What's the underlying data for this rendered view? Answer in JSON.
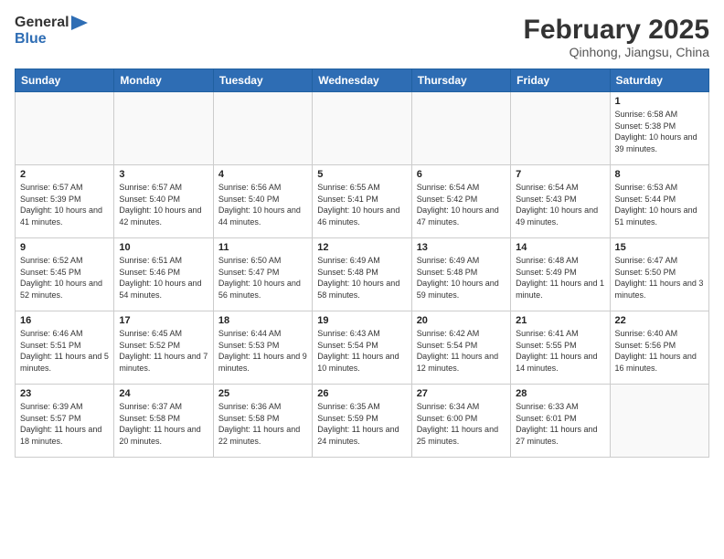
{
  "header": {
    "logo": {
      "general": "General",
      "blue": "Blue"
    },
    "title": "February 2025",
    "location": "Qinhong, Jiangsu, China"
  },
  "weekdays": [
    "Sunday",
    "Monday",
    "Tuesday",
    "Wednesday",
    "Thursday",
    "Friday",
    "Saturday"
  ],
  "weeks": [
    [
      {
        "day": "",
        "info": ""
      },
      {
        "day": "",
        "info": ""
      },
      {
        "day": "",
        "info": ""
      },
      {
        "day": "",
        "info": ""
      },
      {
        "day": "",
        "info": ""
      },
      {
        "day": "",
        "info": ""
      },
      {
        "day": "1",
        "info": "Sunrise: 6:58 AM\nSunset: 5:38 PM\nDaylight: 10 hours and 39 minutes."
      }
    ],
    [
      {
        "day": "2",
        "info": "Sunrise: 6:57 AM\nSunset: 5:39 PM\nDaylight: 10 hours and 41 minutes."
      },
      {
        "day": "3",
        "info": "Sunrise: 6:57 AM\nSunset: 5:40 PM\nDaylight: 10 hours and 42 minutes."
      },
      {
        "day": "4",
        "info": "Sunrise: 6:56 AM\nSunset: 5:40 PM\nDaylight: 10 hours and 44 minutes."
      },
      {
        "day": "5",
        "info": "Sunrise: 6:55 AM\nSunset: 5:41 PM\nDaylight: 10 hours and 46 minutes."
      },
      {
        "day": "6",
        "info": "Sunrise: 6:54 AM\nSunset: 5:42 PM\nDaylight: 10 hours and 47 minutes."
      },
      {
        "day": "7",
        "info": "Sunrise: 6:54 AM\nSunset: 5:43 PM\nDaylight: 10 hours and 49 minutes."
      },
      {
        "day": "8",
        "info": "Sunrise: 6:53 AM\nSunset: 5:44 PM\nDaylight: 10 hours and 51 minutes."
      }
    ],
    [
      {
        "day": "9",
        "info": "Sunrise: 6:52 AM\nSunset: 5:45 PM\nDaylight: 10 hours and 52 minutes."
      },
      {
        "day": "10",
        "info": "Sunrise: 6:51 AM\nSunset: 5:46 PM\nDaylight: 10 hours and 54 minutes."
      },
      {
        "day": "11",
        "info": "Sunrise: 6:50 AM\nSunset: 5:47 PM\nDaylight: 10 hours and 56 minutes."
      },
      {
        "day": "12",
        "info": "Sunrise: 6:49 AM\nSunset: 5:48 PM\nDaylight: 10 hours and 58 minutes."
      },
      {
        "day": "13",
        "info": "Sunrise: 6:49 AM\nSunset: 5:48 PM\nDaylight: 10 hours and 59 minutes."
      },
      {
        "day": "14",
        "info": "Sunrise: 6:48 AM\nSunset: 5:49 PM\nDaylight: 11 hours and 1 minute."
      },
      {
        "day": "15",
        "info": "Sunrise: 6:47 AM\nSunset: 5:50 PM\nDaylight: 11 hours and 3 minutes."
      }
    ],
    [
      {
        "day": "16",
        "info": "Sunrise: 6:46 AM\nSunset: 5:51 PM\nDaylight: 11 hours and 5 minutes."
      },
      {
        "day": "17",
        "info": "Sunrise: 6:45 AM\nSunset: 5:52 PM\nDaylight: 11 hours and 7 minutes."
      },
      {
        "day": "18",
        "info": "Sunrise: 6:44 AM\nSunset: 5:53 PM\nDaylight: 11 hours and 9 minutes."
      },
      {
        "day": "19",
        "info": "Sunrise: 6:43 AM\nSunset: 5:54 PM\nDaylight: 11 hours and 10 minutes."
      },
      {
        "day": "20",
        "info": "Sunrise: 6:42 AM\nSunset: 5:54 PM\nDaylight: 11 hours and 12 minutes."
      },
      {
        "day": "21",
        "info": "Sunrise: 6:41 AM\nSunset: 5:55 PM\nDaylight: 11 hours and 14 minutes."
      },
      {
        "day": "22",
        "info": "Sunrise: 6:40 AM\nSunset: 5:56 PM\nDaylight: 11 hours and 16 minutes."
      }
    ],
    [
      {
        "day": "23",
        "info": "Sunrise: 6:39 AM\nSunset: 5:57 PM\nDaylight: 11 hours and 18 minutes."
      },
      {
        "day": "24",
        "info": "Sunrise: 6:37 AM\nSunset: 5:58 PM\nDaylight: 11 hours and 20 minutes."
      },
      {
        "day": "25",
        "info": "Sunrise: 6:36 AM\nSunset: 5:58 PM\nDaylight: 11 hours and 22 minutes."
      },
      {
        "day": "26",
        "info": "Sunrise: 6:35 AM\nSunset: 5:59 PM\nDaylight: 11 hours and 24 minutes."
      },
      {
        "day": "27",
        "info": "Sunrise: 6:34 AM\nSunset: 6:00 PM\nDaylight: 11 hours and 25 minutes."
      },
      {
        "day": "28",
        "info": "Sunrise: 6:33 AM\nSunset: 6:01 PM\nDaylight: 11 hours and 27 minutes."
      },
      {
        "day": "",
        "info": ""
      }
    ]
  ]
}
